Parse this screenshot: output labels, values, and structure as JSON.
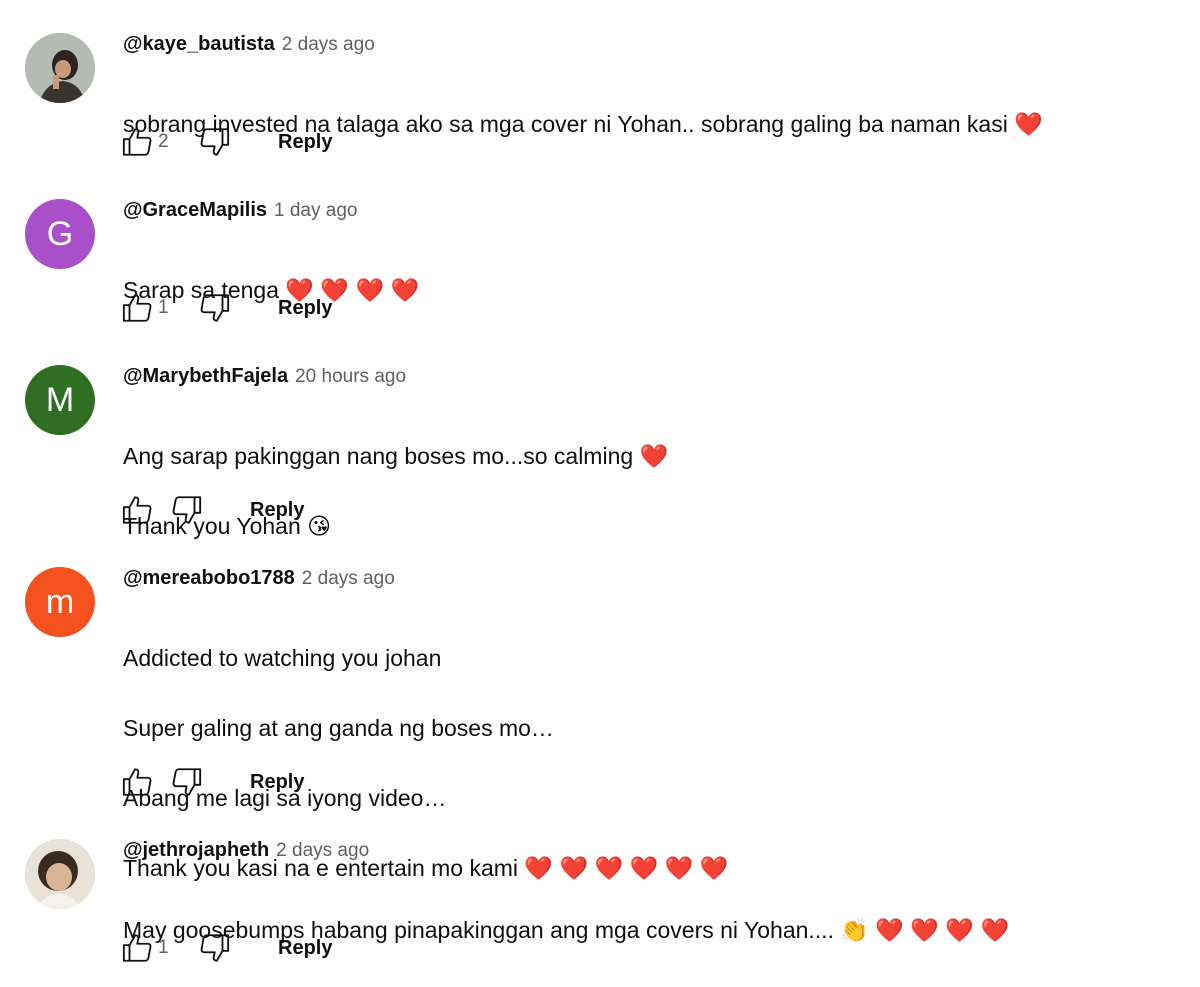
{
  "comments": [
    {
      "author": "@kaye_bautista",
      "time": "2 days ago",
      "lines": [
        "sobrang invested na talaga ako sa mga cover ni Yohan.. sobrang galing ba naman kasi ❤️"
      ],
      "likes": "2",
      "reply_label": "Reply",
      "avatar": {
        "type": "photo",
        "color": "#9aa09a"
      }
    },
    {
      "author": "@GraceMapilis",
      "time": "1 day ago",
      "lines": [
        "Sarap sa tenga ❤️ ❤️ ❤️ ❤️"
      ],
      "likes": "1",
      "reply_label": "Reply",
      "avatar": {
        "type": "letter",
        "letter": "G",
        "color": "#a94fc9"
      }
    },
    {
      "author": "@MarybethFajela",
      "time": "20 hours ago",
      "lines": [
        "Ang sarap pakinggan nang boses mo...so calming ❤️",
        "Thank you Yohan 😘"
      ],
      "likes": "",
      "reply_label": "Reply",
      "avatar": {
        "type": "letter",
        "letter": "M",
        "color": "#2f6e23"
      }
    },
    {
      "author": "@mereabobo1788",
      "time": "2 days ago",
      "lines": [
        "Addicted to watching you johan",
        "Super galing at ang ganda ng boses mo…",
        "Abang me lagi sa iyong video…",
        "Thank you kasi na e entertain mo kami ❤️ ❤️ ❤️ ❤️ ❤️ ❤️"
      ],
      "likes": "",
      "reply_label": "Reply",
      "avatar": {
        "type": "letter",
        "letter": "m",
        "color": "#f4511e"
      }
    },
    {
      "author": "@jethrojapheth",
      "time": "2 days ago",
      "lines": [
        "May goosebumps habang pinapakinggan ang mga covers ni Yohan.... 👏 ❤️ ❤️ ❤️ ❤️"
      ],
      "likes": "1",
      "reply_label": "Reply",
      "avatar": {
        "type": "photo",
        "color": "#c9b79f"
      }
    }
  ]
}
